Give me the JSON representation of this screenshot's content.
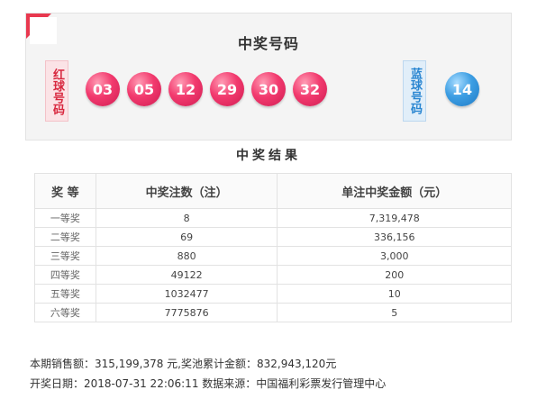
{
  "header": {
    "title": "中奖号码"
  },
  "labels": {
    "red": "红球号码",
    "blue": "蓝球号码"
  },
  "red_balls": [
    "03",
    "05",
    "12",
    "29",
    "30",
    "32"
  ],
  "blue_balls": [
    "14"
  ],
  "results": {
    "title": "中奖结果",
    "columns": [
      "奖 等",
      "中奖注数（注）",
      "单注中奖金额（元）"
    ],
    "rows": [
      {
        "level": "一等奖",
        "count": "8",
        "amount": "7,319,478"
      },
      {
        "level": "二等奖",
        "count": "69",
        "amount": "336,156"
      },
      {
        "level": "三等奖",
        "count": "880",
        "amount": "3,000"
      },
      {
        "level": "四等奖",
        "count": "49122",
        "amount": "200"
      },
      {
        "level": "五等奖",
        "count": "1032477",
        "amount": "10"
      },
      {
        "level": "六等奖",
        "count": "7775876",
        "amount": "5"
      }
    ]
  },
  "footer": {
    "sales_line": "本期销售额：315,199,378 元,奖池累计金额：832,943,120元",
    "date_line": "开奖日期：2018-07-31 22:06:11 数据来源：中国福利彩票发行管理中心"
  },
  "colors": {
    "red_ball": "#e8336a",
    "blue_ball": "#3a9be0",
    "accent": "#e8384f"
  }
}
